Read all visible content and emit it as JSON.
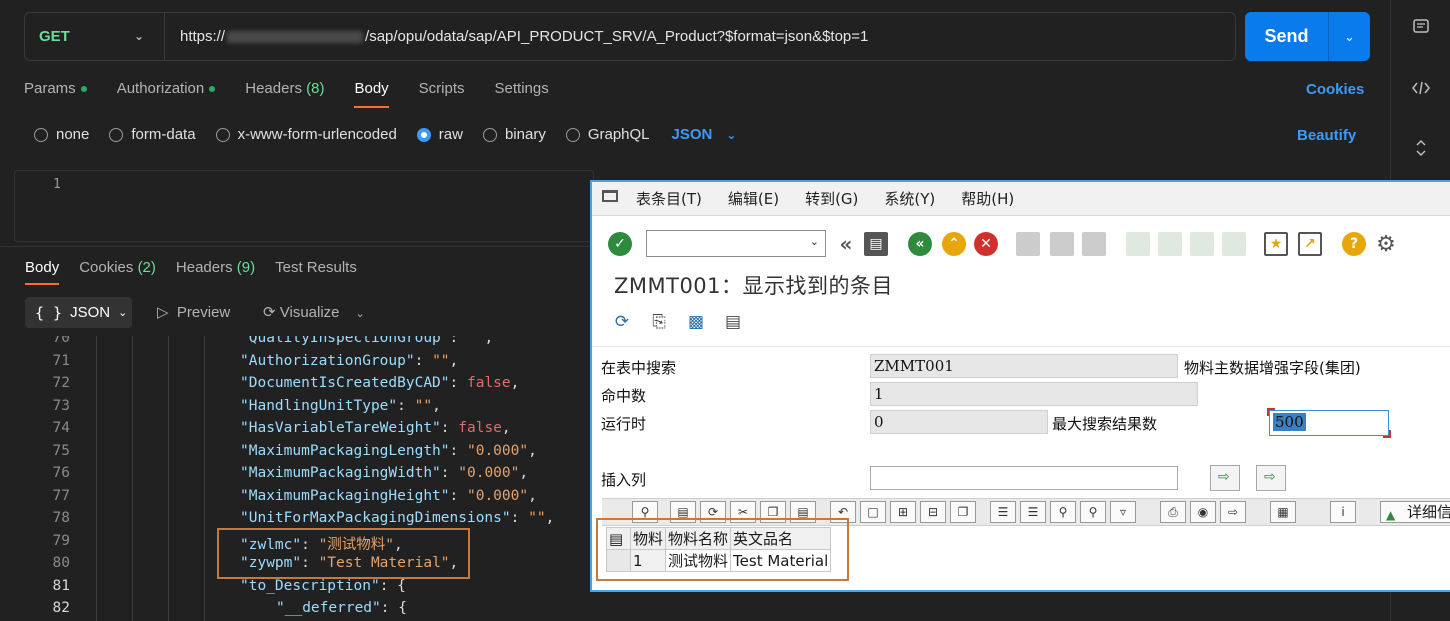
{
  "request": {
    "method": "GET",
    "url_prefix": "https://",
    "url_path": "/sap/opu/odata/sap/API_PRODUCT_SRV/A_Product?$format=json&$top=1",
    "send_label": "Send"
  },
  "req_tabs": [
    {
      "label": "Params",
      "count": ""
    },
    {
      "label": "Authorization",
      "count": ""
    },
    {
      "label": "Headers ",
      "count": "(8)"
    },
    {
      "label": "Body",
      "count": ""
    },
    {
      "label": "Scripts",
      "count": ""
    },
    {
      "label": "Settings",
      "count": ""
    }
  ],
  "cookies_label": "Cookies",
  "body_types": [
    "none",
    "form-data",
    "x-www-form-urlencoded",
    "raw",
    "binary",
    "GraphQL"
  ],
  "body_format": "JSON",
  "beautify_label": "Beautify",
  "editor_line": "1",
  "resp_tabs": [
    {
      "label": "Body",
      "count": ""
    },
    {
      "label": "Cookies ",
      "count": "(2)"
    },
    {
      "label": "Headers ",
      "count": "(9)"
    },
    {
      "label": "Test Results",
      "count": ""
    }
  ],
  "resp_format": "JSON",
  "preview_label": "Preview",
  "visualize_label": "Visualize",
  "code": [
    {
      "n": "70",
      "key": "\"QualityInspectionGroup\"",
      "val": "\"\"",
      "type": "s"
    },
    {
      "n": "71",
      "key": "\"AuthorizationGroup\"",
      "val": "\"\"",
      "type": "s"
    },
    {
      "n": "72",
      "key": "\"DocumentIsCreatedByCAD\"",
      "val": "false",
      "type": "b"
    },
    {
      "n": "73",
      "key": "\"HandlingUnitType\"",
      "val": "\"\"",
      "type": "s"
    },
    {
      "n": "74",
      "key": "\"HasVariableTareWeight\"",
      "val": "false",
      "type": "b"
    },
    {
      "n": "75",
      "key": "\"MaximumPackagingLength\"",
      "val": "\"0.000\"",
      "type": "s"
    },
    {
      "n": "76",
      "key": "\"MaximumPackagingWidth\"",
      "val": "\"0.000\"",
      "type": "s"
    },
    {
      "n": "77",
      "key": "\"MaximumPackagingHeight\"",
      "val": "\"0.000\"",
      "type": "s"
    },
    {
      "n": "78",
      "key": "\"UnitForMaxPackagingDimensions\"",
      "val": "\"\"",
      "type": "s"
    },
    {
      "n": "79",
      "key": "\"zwlmc\"",
      "val": "\"测试物料\"",
      "type": "s"
    },
    {
      "n": "80",
      "key": "\"zywpm\"",
      "val": "\"Test Material\"",
      "type": "s"
    },
    {
      "n": "81",
      "key": "\"to_Description\"",
      "val": "{",
      "type": "p"
    },
    {
      "n": "82",
      "key": "\"__deferred\"",
      "val": "{",
      "type": "p"
    }
  ],
  "sap": {
    "menus": [
      "表条目(T)",
      "编辑(E)",
      "转到(G)",
      "系统(Y)",
      "帮助(H)"
    ],
    "title": "ZMMT001：显示找到的条目",
    "search_label": "在表中搜索",
    "search_value": "ZMMT001",
    "search_desc": "物料主数据增强字段(集团)",
    "hits_label": "命中数",
    "hits_value": "1",
    "runtime_label": "运行时",
    "runtime_value": "0",
    "max_label": "最大搜索结果数",
    "max_value": "500",
    "insert_label": "插入列",
    "detail_label": "详细信息",
    "table_headers": [
      "物料",
      "物料名称",
      "英文品名"
    ],
    "table_row": {
      "num": "1",
      "name": "测试物料",
      "en_name": "Test Material"
    }
  }
}
